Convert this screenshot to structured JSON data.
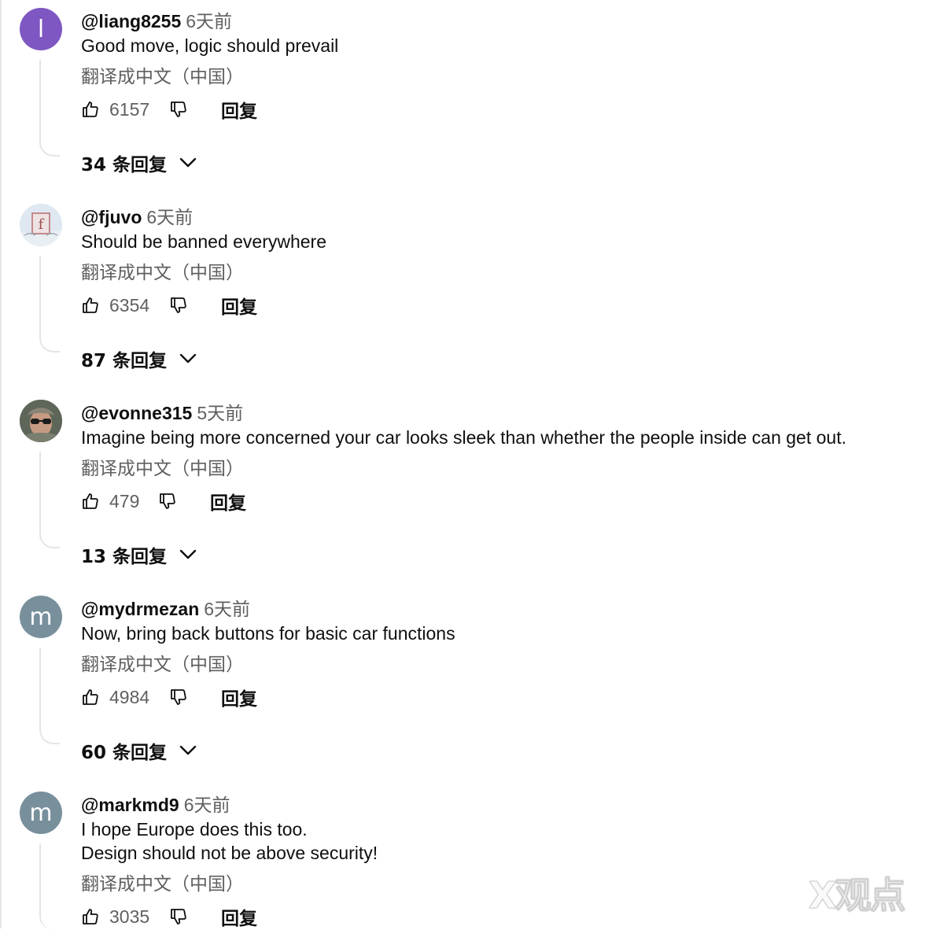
{
  "comments": [
    {
      "author": "@liang8255",
      "time": "6天前",
      "text_lines": [
        "Good move, logic should prevail"
      ],
      "translate": "翻译成中文（中国）",
      "likes": "6157",
      "reply": "回复",
      "replies": "34 条回复",
      "avatar": {
        "letter": "l",
        "color": "#7e57c2"
      }
    },
    {
      "author": "@fjuvo",
      "time": "6天前",
      "text_lines": [
        "Should be banned everywhere"
      ],
      "translate": "翻译成中文（中国）",
      "likes": "6354",
      "reply": "回复",
      "replies": "87 条回复",
      "avatar": {
        "letter": "f",
        "color": "#d7e3ef"
      }
    },
    {
      "author": "@evonne315",
      "time": "5天前",
      "text_lines": [
        "Imagine being more concerned your car looks sleek than whether the people inside can get out."
      ],
      "translate": "翻译成中文（中国）",
      "likes": "479",
      "reply": "回复",
      "replies": "13 条回复",
      "avatar": {
        "letter": "",
        "color": "#6b7266"
      }
    },
    {
      "author": "@mydrmezan",
      "time": "6天前",
      "text_lines": [
        "Now, bring back buttons for basic car functions"
      ],
      "translate": "翻译成中文（中国）",
      "likes": "4984",
      "reply": "回复",
      "replies": "60 条回复",
      "avatar": {
        "letter": "m",
        "color": "#78909c"
      }
    },
    {
      "author": "@markmd9",
      "time": "6天前",
      "text_lines": [
        "I hope Europe does this too.",
        "Design should not be above security!"
      ],
      "translate": "翻译成中文（中国）",
      "likes": "3035",
      "reply": "回复",
      "replies": "",
      "avatar": {
        "letter": "m",
        "color": "#78909c"
      }
    }
  ],
  "watermark": "X观点"
}
